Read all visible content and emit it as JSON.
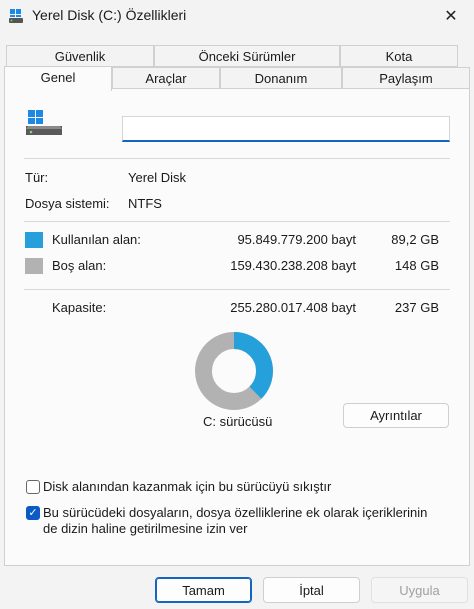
{
  "window": {
    "title": "Yerel Disk (C:) Özellikleri",
    "close_glyph": "✕"
  },
  "tabs": {
    "row1": [
      {
        "label": "Güvenlik"
      },
      {
        "label": "Önceki Sürümler"
      },
      {
        "label": "Kota"
      }
    ],
    "row2": [
      {
        "label": "Genel"
      },
      {
        "label": "Araçlar"
      },
      {
        "label": "Donanım"
      },
      {
        "label": "Paylaşım"
      }
    ],
    "active": "Genel"
  },
  "general": {
    "drive_name_value": "",
    "type_label": "Tür:",
    "type_value": "Yerel Disk",
    "fs_label": "Dosya sistemi:",
    "fs_value": "NTFS",
    "used": {
      "label": "Kullanılan alan:",
      "bytes": "95.849.779.200 bayt",
      "size": "89,2 GB",
      "color": "#26a0da"
    },
    "free": {
      "label": "Boş alan:",
      "bytes": "159.430.238.208 bayt",
      "size": "148 GB",
      "color": "#b2b2b2"
    },
    "capacity": {
      "label": "Kapasite:",
      "bytes": "255.280.017.408 bayt",
      "size": "237 GB"
    },
    "used_fraction": 0.3755,
    "drive_label": "C: sürücüsü",
    "details_button": "Ayrıntılar",
    "compress": {
      "label": "Disk alanından kazanmak için bu sürücüyü sıkıştır",
      "checked": false
    },
    "index": {
      "label_line1": "Bu sürücüdeki dosyaların, dosya özelliklerine ek olarak içeriklerinin",
      "label_line2": "de dizin haline getirilmesine izin ver",
      "checked": true
    }
  },
  "footer": {
    "ok": "Tamam",
    "cancel": "İptal",
    "apply": "Uygula"
  },
  "icons": {
    "title": "drive-icon",
    "close": "close-icon",
    "check": "checkmark-icon"
  }
}
